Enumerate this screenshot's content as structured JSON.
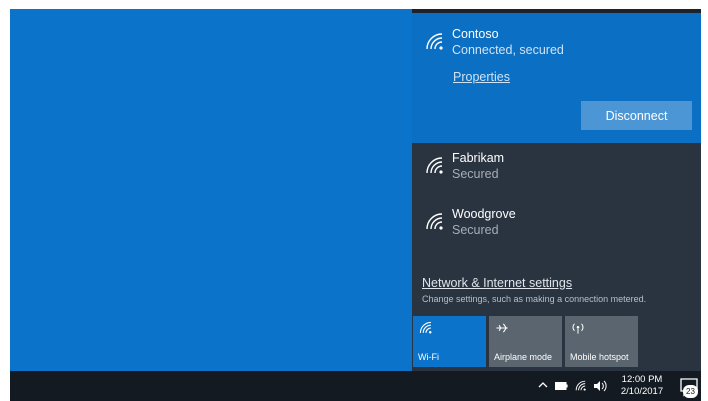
{
  "colors": {
    "desktop": "#0b73c9",
    "flyout_bg": "#2a3440",
    "connected_bg": "#0b6fc4",
    "disconnect_bg": "#4c96d6",
    "tile_active": "#0b73c9",
    "tile_inactive": "#5a6570",
    "taskbar": "#141a22"
  },
  "connected_network": {
    "name": "Contoso",
    "status": "Connected, secured",
    "properties_label": "Properties",
    "disconnect_label": "Disconnect",
    "icon": "wifi-icon"
  },
  "networks": [
    {
      "name": "Fabrikam",
      "status": "Secured",
      "icon": "wifi-icon"
    },
    {
      "name": "Woodgrove",
      "status": "Secured",
      "icon": "wifi-icon"
    }
  ],
  "settings": {
    "link_label": "Network & Internet settings",
    "description": "Change settings, such as making a connection metered."
  },
  "quick_actions": [
    {
      "label": "Wi-Fi",
      "icon": "wifi-icon",
      "active": true
    },
    {
      "label": "Airplane mode",
      "icon": "airplane-icon",
      "active": false
    },
    {
      "label": "Mobile hotspot",
      "icon": "hotspot-icon",
      "active": false
    }
  ],
  "taskbar": {
    "time": "12:00 PM",
    "date": "2/10/2017",
    "notification_count": "23",
    "icons": [
      "chevron-up-icon",
      "battery-icon",
      "wifi-icon",
      "volume-icon",
      "action-center-icon"
    ]
  }
}
